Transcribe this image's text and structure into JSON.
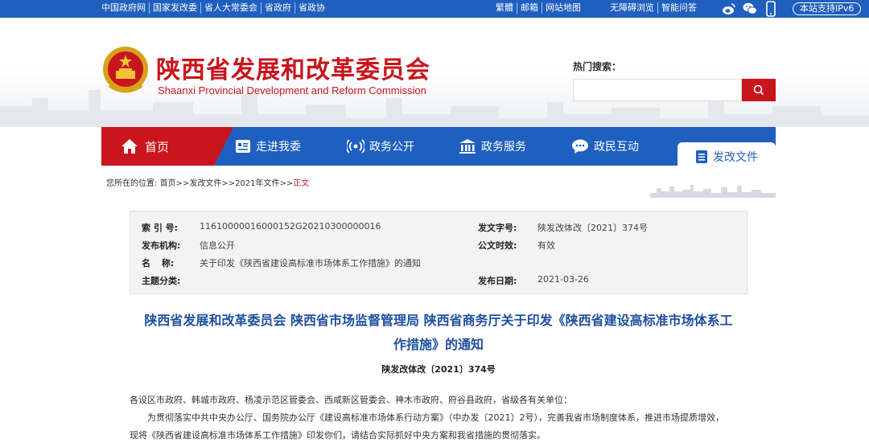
{
  "topbar": {
    "links": [
      "中国政府网",
      "国家发改委",
      "省人大常委会",
      "省政府",
      "省政协"
    ],
    "right_links": [
      "繁體",
      "邮箱",
      "网站地图"
    ],
    "right_links2": [
      "无障碍浏览",
      "智能问答"
    ],
    "social_icons": [
      "weibo-icon",
      "wechat-icon",
      "mobile-icon"
    ],
    "ipv6": "本站支持IPv6"
  },
  "header": {
    "title": "陕西省发展和改革委员会",
    "subtitle": "Shaanxi Provincial Development and Reform Commission",
    "hot_search_label": "热门搜索：",
    "search_placeholder": ""
  },
  "nav": {
    "home": "首页",
    "items": [
      "走进我委",
      "政务公开",
      "政务服务",
      "政民互动"
    ],
    "active": "发改文件"
  },
  "breadcrumb": {
    "prefix": "您所在的位置: ",
    "path": "首页>>发改文件>>2021年文件>>",
    "current": "正文"
  },
  "meta": {
    "index_label": "索 引 号:",
    "index_value": "11610000016000152G20210300000016",
    "doc_no_label": "发文字号:",
    "doc_no_value": "陕发改体改〔2021〕374号",
    "org_label": "发布机构:",
    "org_value": "信息公开",
    "validity_label": "公文时效:",
    "validity_value": "有效",
    "name_label": "名 称:",
    "name_value": "关于印发《陕西省建设高标准市场体系工作措施》的通知",
    "topic_label": "主题分类:",
    "topic_value": "",
    "date_label": "发布日期:",
    "date_value": "2021-03-26"
  },
  "article": {
    "title_line1": "陕西省发展和改革委员会 陕西省市场监督管理局 陕西省商务厅关于印发《陕西省建设高标准市场体系工",
    "title_line2": "作措施》的通知",
    "doc_no": "陕发改体改〔2021〕374号",
    "recipients": "各设区市政府、韩城市政府、杨凌示范区管委会、西咸新区管委会、神木市政府、府谷县政府，省级各有关单位：",
    "para1": "为贯彻落实中共中央办公厅、国务院办公厅《建设高标准市场体系行动方案》（中办发〔2021〕2号），完善我省市场制度体系，推进市场提质增效，",
    "para1_cont": "现将《陕西省建设高标准市场体系工作措施》印发你们，请结合实际抓好中央方案和我省措施的贯彻落实。"
  },
  "colors": {
    "brand_blue": "#1f5fbf",
    "brand_red": "#c9151e",
    "title_blue": "#1f4fa0"
  }
}
